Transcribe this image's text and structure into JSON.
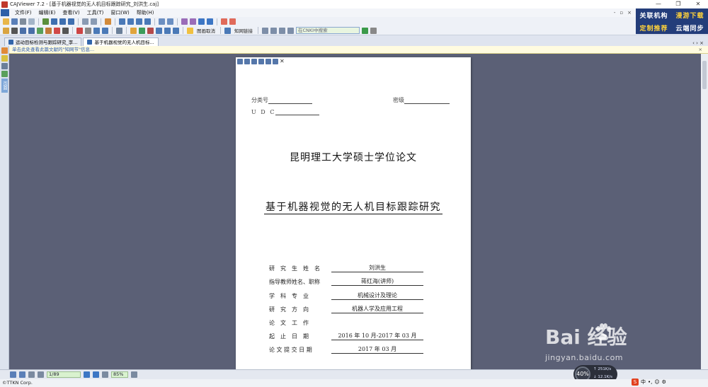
{
  "window": {
    "title": "CAJViewer 7.2 - [基于机器视觉的无人机目标跟踪研究_刘洪生.caj]",
    "minimize": "—",
    "maximize": "❐",
    "close": "✕"
  },
  "menu": {
    "items": [
      "文件(F)",
      "编辑(E)",
      "查看(V)",
      "工具(T)",
      "窗口(W)",
      "帮助(H)"
    ],
    "right_controls": [
      "‑",
      "▫",
      "×"
    ]
  },
  "promo": {
    "line1a": "关联机构",
    "line1b": "漫游下载",
    "line2a": "定制推荐",
    "line2b": "云端同步"
  },
  "toolbar": {
    "mark_label": "图画取消",
    "select_label": "知网链接",
    "search_placeholder": "在CNKI中搜索"
  },
  "tabs": [
    {
      "label": "运动目标检测与跟踪研究_李..."
    },
    {
      "label": "基于机器视觉的无人机目标..."
    }
  ],
  "tab_controls": "‹ ›  ×",
  "sidebar": {
    "vertical_tab": "页面"
  },
  "infobar": {
    "text": "单击此处查看此篇文献的\"知网节\"信息...",
    "close": "×"
  },
  "document": {
    "class_label": "分类号",
    "secret_label": "密级",
    "udc_label": "U D C",
    "university_title": "昆明理工大学硕士学位论文",
    "thesis_title": "基于机器视觉的无人机目标跟踪研究",
    "fields": [
      {
        "label": "研　究　生　姓　名",
        "value": "刘洪生"
      },
      {
        "label": "指导教师姓名、职称",
        "value": "蒋红海(讲师)"
      },
      {
        "label": "学　科　专　业",
        "value": "机械设计及理论"
      },
      {
        "label": "研　究　方　向",
        "value": "机器人学及应用工程"
      },
      {
        "label": "论　文　工　作",
        "value": ""
      },
      {
        "label": "起　止　日　期",
        "value": "2016 年 10 月-2017 年 03 月"
      },
      {
        "label": "论 文 提 交 日 期",
        "value": "2017 年 03 月"
      }
    ]
  },
  "statusbar": {
    "page": "1/89",
    "zoom": "85%"
  },
  "bottom": {
    "company": "©TTKN Corp."
  },
  "netwidget": {
    "percent": "40%",
    "up": "↑ 251K/s",
    "down": "↓ 12.1K/s"
  },
  "ime": {
    "label": "中"
  },
  "watermark": {
    "brand": "Bai  经验",
    "url": "jingyan.baidu.com"
  },
  "colors": {
    "doc_background": "#5b6076",
    "promo_background": "#233d7a",
    "promo_highlight": "#ffd23a"
  }
}
